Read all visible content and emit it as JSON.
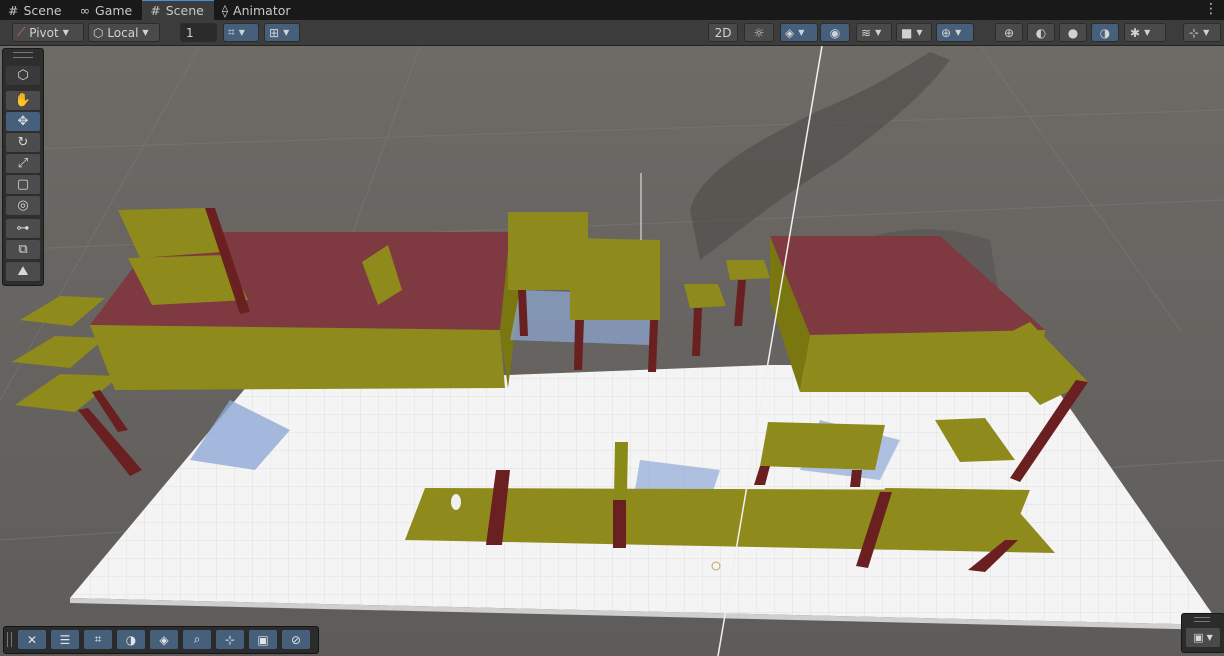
{
  "tabs": [
    {
      "label": "Scene",
      "icon": "grid-icon"
    },
    {
      "label": "Game",
      "icon": "gamepad-icon"
    },
    {
      "label": "Scene",
      "icon": "grid-icon",
      "active": true
    },
    {
      "label": "Animator",
      "icon": "animator-icon"
    }
  ],
  "toolbar": {
    "pivot_label": "Pivot",
    "local_label": "Local",
    "grid_size_value": "1"
  },
  "tools": [
    "hand-tool",
    "move-tool",
    "rotate-tool",
    "scale-tool",
    "rect-tool",
    "transform-tool",
    "custom-tool",
    "view-tool",
    "camera-tool"
  ],
  "colors": {
    "accent": "#46607c",
    "floor": "#f2f2f2",
    "furniture": "#8f8a1a",
    "legs": "#6a2020",
    "table_top": "#7e3a40"
  }
}
